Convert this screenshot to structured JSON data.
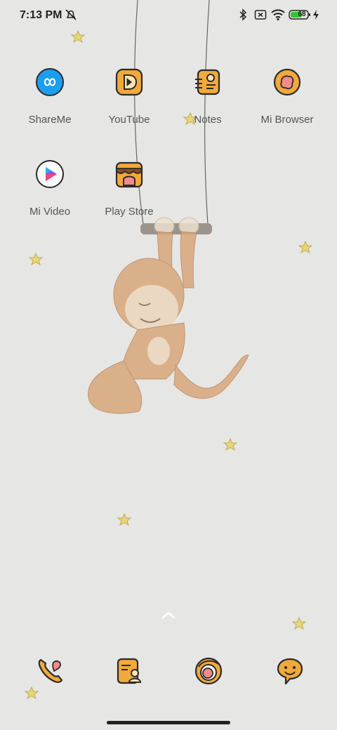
{
  "status_bar": {
    "time": "7:13 PM",
    "battery_level": "68",
    "icons": [
      "alarm-off-icon",
      "bluetooth-icon",
      "sim-x-icon",
      "wifi-icon",
      "battery-icon",
      "charging-bolt-icon"
    ],
    "battery_color": "#35c235"
  },
  "home": {
    "apps": [
      {
        "label": "ShareMe",
        "icon": "shareme-icon"
      },
      {
        "label": "YouTube",
        "icon": "youtube-icon"
      },
      {
        "label": "Notes",
        "icon": "notes-icon"
      },
      {
        "label": "Mi Browser",
        "icon": "mi-browser-icon"
      },
      {
        "label": "Mi Video",
        "icon": "mi-video-icon"
      },
      {
        "label": "Play Store",
        "icon": "play-store-icon"
      }
    ],
    "drawer_icon": "chevron-up-icon"
  },
  "dock": {
    "apps": [
      {
        "icon": "phone-icon"
      },
      {
        "icon": "contacts-icon"
      },
      {
        "icon": "camera-icon"
      },
      {
        "icon": "messages-icon"
      }
    ]
  },
  "colors": {
    "background": "#e6e6e4",
    "icon_orange": "#f2a93b",
    "icon_outline": "#2b2b2b",
    "shareme_blue": "#1a9ef0",
    "monkey": "#d9a77c",
    "star": "#e7d57a"
  }
}
